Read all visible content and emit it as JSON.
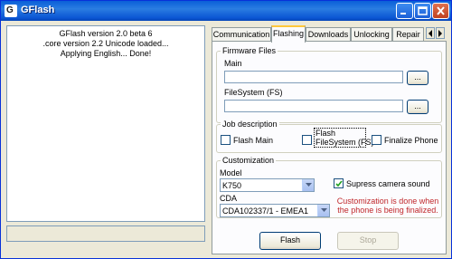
{
  "window": {
    "title": "GFlash"
  },
  "log": {
    "lines": [
      "GFlash version 2.0 beta 6",
      ".core version 2.2 Unicode loaded...",
      "Applying English... Done!"
    ]
  },
  "status_text": "",
  "tabs": [
    "Communication",
    "Flashing",
    "Downloads",
    "Unlocking",
    "Repair"
  ],
  "active_tab": "Flashing",
  "firmware": {
    "group_title": "Firmware Files",
    "main_label": "Main",
    "main_value": "",
    "fs_label": "FileSystem (FS)",
    "fs_value": "",
    "browse_label": "..."
  },
  "job": {
    "group_title": "Job description",
    "flash_main": {
      "label": "Flash Main",
      "checked": false
    },
    "flash_fs": {
      "label_line1": "Flash",
      "label_line2": "FileSystem (FS)",
      "checked": false
    },
    "finalize": {
      "label": "Finalize Phone",
      "checked": false
    }
  },
  "customization": {
    "group_title": "Customization",
    "model_label": "Model",
    "model_value": "K750",
    "cda_label": "CDA",
    "cda_value": "CDA102337/1 - EMEA1",
    "supress_label": "Supress camera sound",
    "supress_checked": true,
    "note_line1": "Customization is done when",
    "note_line2": "the phone is being finalized."
  },
  "buttons": {
    "flash": "Flash",
    "stop": "Stop"
  },
  "colors": {
    "title_blue": "#0a5fd8",
    "note_red": "#c0282c",
    "tab_highlight": "#ffc83c"
  }
}
